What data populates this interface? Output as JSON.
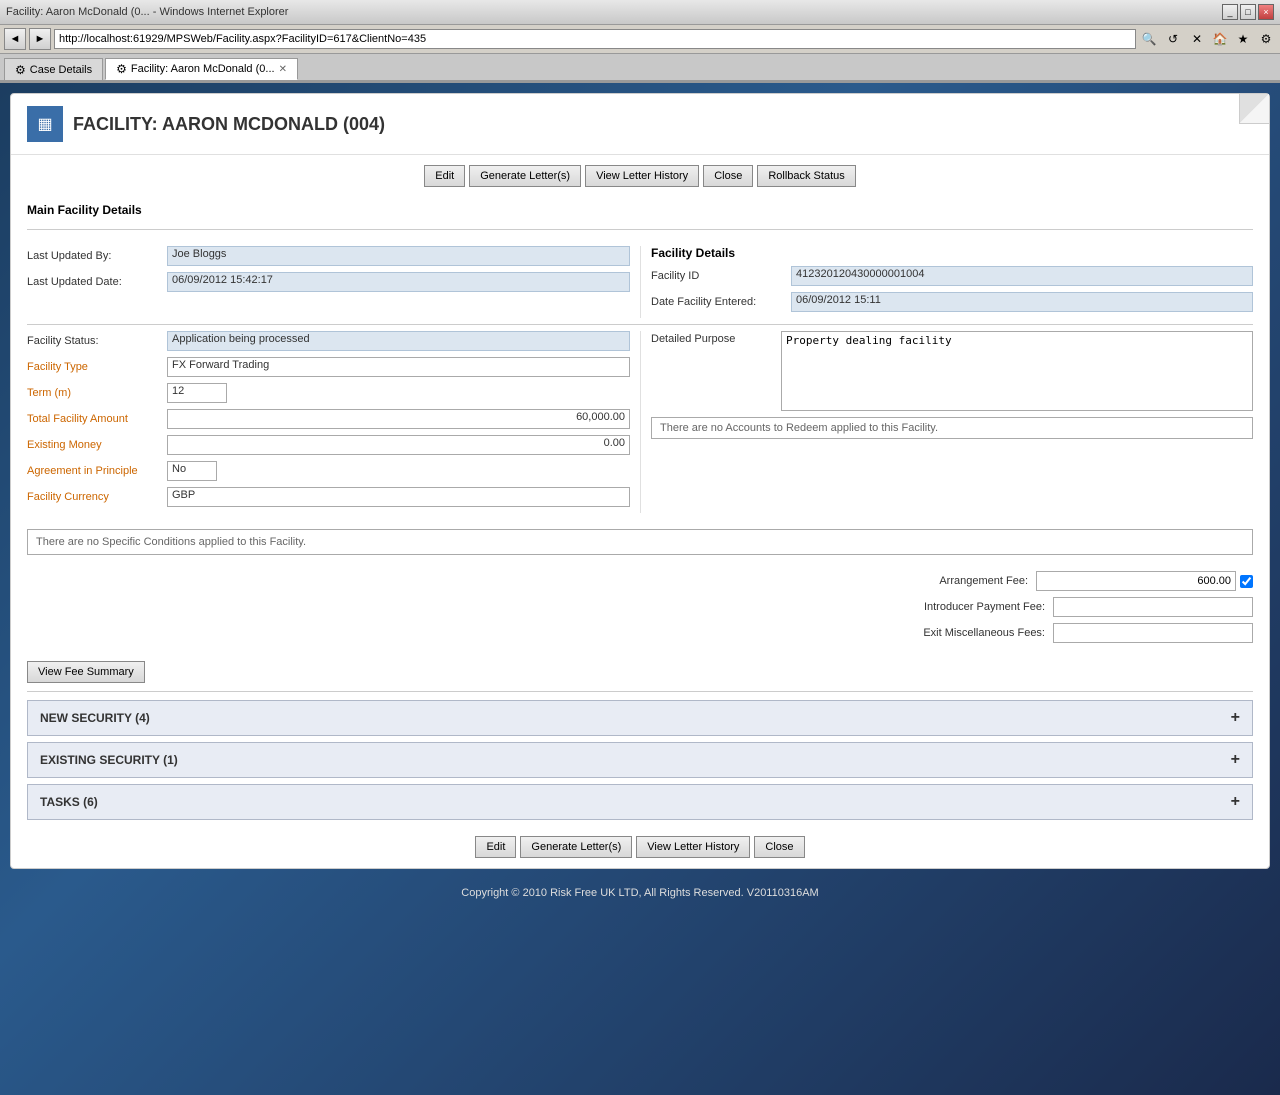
{
  "browser": {
    "url": "http://localhost:61929/MPSWeb/Facility.aspx?FacilityID=617&ClientNo=435",
    "tabs": [
      {
        "label": "Case Details",
        "active": false,
        "icon": "⚙"
      },
      {
        "label": "Facility: Aaron McDonald (0...",
        "active": true,
        "icon": "⚙"
      }
    ],
    "title_bar_buttons": [
      "_",
      "□",
      "×"
    ]
  },
  "header": {
    "title": "FACILITY: AARON MCDONALD (004)",
    "icon": "▦"
  },
  "action_bar": {
    "edit_label": "Edit",
    "generate_letters_label": "Generate Letter(s)",
    "view_letter_history_label": "View Letter History",
    "close_label": "Close",
    "rollback_status_label": "Rollback Status"
  },
  "main_section_title": "Main Facility Details",
  "left_fields": {
    "last_updated_by_label": "Last Updated By:",
    "last_updated_by_value": "Joe Bloggs",
    "last_updated_date_label": "Last Updated Date:",
    "last_updated_date_value": "06/09/2012 15:42:17"
  },
  "facility_status": {
    "label": "Facility Status:",
    "value": "Application being processed"
  },
  "form_fields": {
    "facility_type_label": "Facility Type",
    "facility_type_value": "FX Forward Trading",
    "term_label": "Term (m)",
    "term_value": "12",
    "total_facility_amount_label": "Total Facility Amount",
    "total_facility_amount_value": "60,000.00",
    "existing_money_label": "Existing Money",
    "existing_money_value": "0.00",
    "agreement_in_principle_label": "Agreement in Principle",
    "agreement_in_principle_value": "No",
    "facility_currency_label": "Facility Currency",
    "facility_currency_value": "GBP"
  },
  "right_section": {
    "title": "Facility Details",
    "facility_id_label": "Facility ID",
    "facility_id_value": "412320120430000001004",
    "date_facility_entered_label": "Date Facility Entered:",
    "date_facility_entered_value": "06/09/2012 15:11",
    "detailed_purpose_label": "Detailed Purpose",
    "detailed_purpose_value": "Property dealing facility",
    "redeem_notice": "There are no Accounts to Redeem applied to this Facility."
  },
  "conditions_notice": "There are no Specific Conditions applied to this Facility.",
  "fees": {
    "arrangement_fee_label": "Arrangement Fee:",
    "arrangement_fee_value": "600.00",
    "arrangement_fee_checked": true,
    "introducer_payment_fee_label": "Introducer Payment Fee:",
    "introducer_payment_fee_value": "",
    "exit_miscellaneous_fees_label": "Exit Miscellaneous Fees:",
    "exit_miscellaneous_fees_value": ""
  },
  "view_fee_summary_label": "View Fee Summary",
  "security_sections": [
    {
      "label": "NEW SECURITY (4)"
    },
    {
      "label": "EXISTING SECURITY (1)"
    },
    {
      "label": "TASKS (6)"
    }
  ],
  "bottom_action_bar": {
    "edit_label": "Edit",
    "generate_letters_label": "Generate Letter(s)",
    "view_letter_history_label": "View Letter History",
    "close_label": "Close"
  },
  "footer": {
    "text": "Copyright © 2010 Risk Free UK LTD, All Rights Reserved. V20110316AM"
  }
}
